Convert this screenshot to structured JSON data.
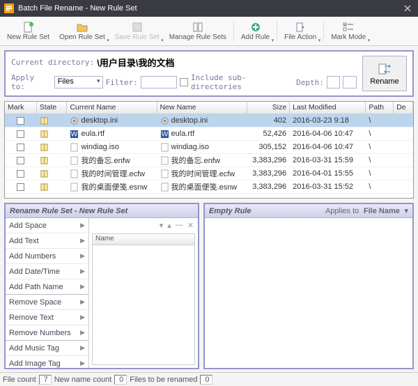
{
  "window": {
    "title": "Batch File Rename - New Rule Set"
  },
  "toolbar": {
    "new_rule_set": "New Rule Set",
    "open_rule_set": "Open Rule Set",
    "save_rule_set": "Save Rule Set",
    "manage_rule_sets": "Manage Rule Sets",
    "add_rule": "Add Rule",
    "file_action": "File Action",
    "mark_mode": "Mark Mode"
  },
  "top": {
    "dir_label": "Current directory:",
    "dir_value": "\\用户目录\\我的文档",
    "apply_to_label": "Apply to:",
    "apply_to_value": "Files",
    "filter_label": "Filter:",
    "filter_value": "",
    "include_sub_label": "Include sub-directories",
    "depth_label": "Depth:",
    "depth_value": "",
    "rename_btn": "Rename"
  },
  "grid": {
    "headers": {
      "mark": "Mark",
      "state": "State",
      "current": "Current Name",
      "new": "New Name",
      "size": "Size",
      "modified": "Last Modified",
      "path": "Path",
      "de": "De"
    },
    "rows": [
      {
        "current": "desktop.ini",
        "new": "desktop.ini",
        "size": "402",
        "modified": "2016-03-23 9:18",
        "path": "\\",
        "icon": "gear",
        "selected": true
      },
      {
        "current": "eula.rtf",
        "new": "eula.rtf",
        "size": "52,426",
        "modified": "2016-04-06 10:47",
        "path": "\\",
        "icon": "word"
      },
      {
        "current": "windiag.iso",
        "new": "windiag.iso",
        "size": "305,152",
        "modified": "2016-04-06 10:47",
        "path": "\\",
        "icon": "file"
      },
      {
        "current": "我的备忘.enfw",
        "new": "我的备忘.enfw",
        "size": "3,383,296",
        "modified": "2016-03-31 15:59",
        "path": "\\",
        "icon": "file"
      },
      {
        "current": "我的时间管理.ecfw",
        "new": "我的时间管理.ecfw",
        "size": "3,383,296",
        "modified": "2016-04-01 15:55",
        "path": "\\",
        "icon": "file"
      },
      {
        "current": "我的桌面便笺.esnw",
        "new": "我的桌面便笺.esnw",
        "size": "3,383,296",
        "modified": "2016-03-31 15:52",
        "path": "\\",
        "icon": "file"
      }
    ]
  },
  "ruleset": {
    "panel_title": "Rename Rule Set - New Rule Set",
    "list_header": "Name",
    "cats": [
      "Add Space",
      "Add Text",
      "Add Numbers",
      "Add Date/Time",
      "Add Path Name",
      "Remove Space",
      "Remove Text",
      "Remove Numbers",
      "Add Music Tag",
      "Add Image Tag"
    ]
  },
  "rulepane": {
    "title": "Empty Rule",
    "applies_label": "Applies to",
    "applies_value": "File Name"
  },
  "status": {
    "file_count_label": "File count",
    "file_count": "7",
    "new_name_label": "New name count",
    "new_name_count": "0",
    "to_rename_label": "Files to be renamed",
    "to_rename_count": "0"
  }
}
